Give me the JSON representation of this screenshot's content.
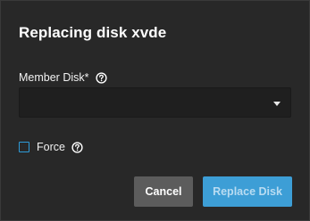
{
  "dialog": {
    "title": "Replacing disk xvde",
    "member_disk": {
      "label": "Member Disk*",
      "help_icon": "help-circle-icon",
      "value": "",
      "arrow_icon": "dropdown-arrow-icon"
    },
    "force": {
      "label": "Force",
      "checked": false,
      "help_icon": "help-circle-icon"
    },
    "buttons": {
      "cancel_label": "Cancel",
      "replace_label": "Replace Disk",
      "replace_disabled": true
    },
    "colors": {
      "background": "#282828",
      "accent": "#3d9ed6",
      "cancel": "#5c5c5c",
      "checkbox_border": "#2e9bd8"
    }
  }
}
